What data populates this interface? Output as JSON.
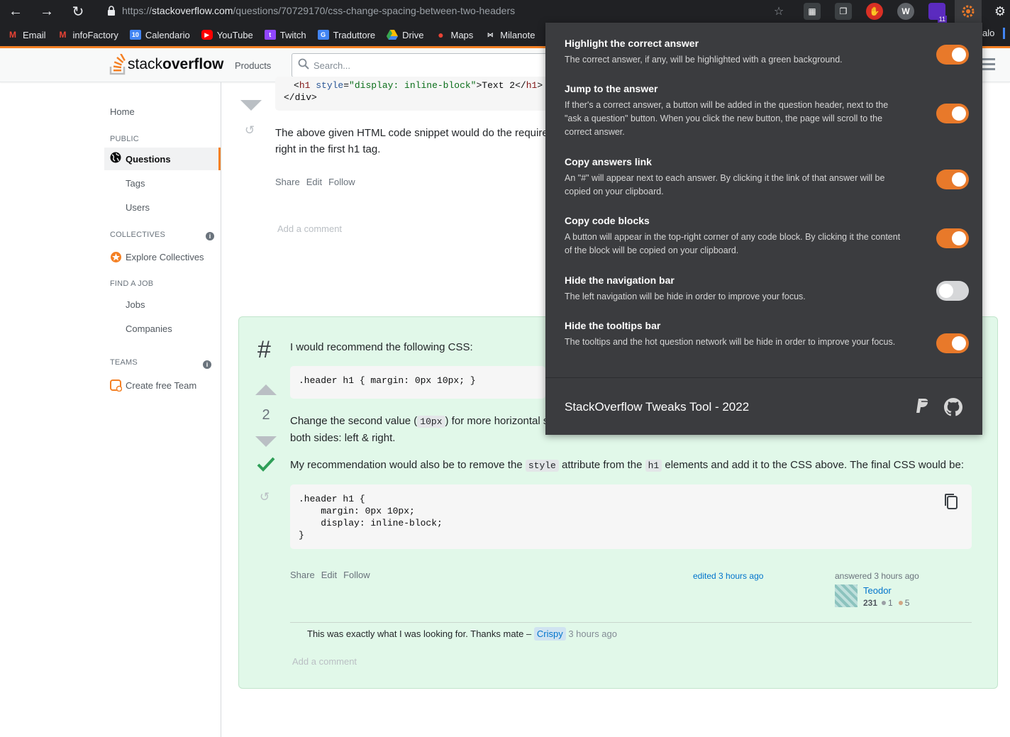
{
  "browser": {
    "url_prefix": "https://",
    "url_host": "stackoverflow.com",
    "url_path": "/questions/70729170/css-change-spacing-between-two-headers",
    "ext_badge": "11",
    "bookmarks": [
      "Email",
      "infoFactory",
      "Calendario",
      "YouTube",
      "Twitch",
      "Traduttore",
      "Drive",
      "Maps",
      "Milanote"
    ],
    "bookmark_overflow": "alo"
  },
  "header": {
    "logo_light": "stack",
    "logo_bold": "overflow",
    "products": "Products",
    "search_placeholder": "Search..."
  },
  "sidebar": {
    "home": "Home",
    "public_head": "PUBLIC",
    "questions": "Questions",
    "tags": "Tags",
    "users": "Users",
    "collectives_head": "COLLECTIVES",
    "explore_collectives": "Explore Collectives",
    "job_head": "FIND A JOB",
    "jobs": "Jobs",
    "companies": "Companies",
    "teams_head": "TEAMS",
    "create_team": "Create free Team"
  },
  "prev_answer": {
    "code_line1_open": "<",
    "code_line1_tag": "h1",
    "code_line1_attr": " style",
    "code_line1_eq": "=",
    "code_line1_val": "\"display: inline-block\"",
    "code_line1_rest": ">Text 2</",
    "code_line1_close": "h1",
    "code_line1_end": ">",
    "code_line2": "</div>",
    "text_line1": "The above given HTML code snippet would do the require",
    "text_line2": "right in the first h1 tag.",
    "share": "Share",
    "edit": "Edit",
    "follow": "Follow",
    "add_comment": "Add a comment"
  },
  "answer": {
    "hash": "#",
    "votes": "2",
    "intro": "I would recommend the following CSS:",
    "code1": ".header h1 { margin: 0px 10px; }",
    "change_pre": "Change the second value (",
    "change_code": "10px",
    "change_post": ") for more horizontal s",
    "change_line2": "both sides: left & right.",
    "rec_pre": "My recommendation would also be to remove the ",
    "rec_code1": "style",
    "rec_mid": " attribute from the ",
    "rec_code2": "h1",
    "rec_post": " elements and add it to the CSS above. The final CSS would be:",
    "code2": ".header h1 {\n    margin: 0px 10px;\n    display: inline-block;\n}",
    "share": "Share",
    "edit": "Edit",
    "follow": "Follow",
    "edited": "edited 3 hours ago",
    "answered": "answered 3 hours ago",
    "user": "Teodor",
    "rep": "231",
    "silver": "1",
    "bronze": "5",
    "comment_text": "This was exactly what I was looking for. Thanks mate –",
    "comment_user": "Crispy",
    "comment_time": "3 hours ago",
    "add_comment": "Add a comment"
  },
  "popup": {
    "options": [
      {
        "title": "Highlight the correct answer",
        "desc": "The correct answer, if any, will be highlighted with a green background.",
        "enabled": true
      },
      {
        "title": "Jump to the answer",
        "desc": "If ther's a correct answer, a button will be added in the question header, next to the \"ask a question\" button. When you click the new button, the page will scroll to the correct answer.",
        "enabled": true
      },
      {
        "title": "Copy answers link",
        "desc": "An \"#\" will appear next to each answer. By clicking it the link of that answer will be copied on your clipboard.",
        "enabled": true
      },
      {
        "title": "Copy code blocks",
        "desc": "A button will appear in the top-right corner of any code block. By clicking it the content of the block will be copied on your clipboard.",
        "enabled": true
      },
      {
        "title": "Hide the navigation bar",
        "desc": "The left navigation will be hide in order to improve your focus.",
        "enabled": false
      },
      {
        "title": "Hide the tooltips bar",
        "desc": "The tooltips and the hot question network will be hide in order to improve your focus.",
        "enabled": true
      }
    ],
    "footer_title": "StackOverflow Tweaks Tool - 2022"
  }
}
